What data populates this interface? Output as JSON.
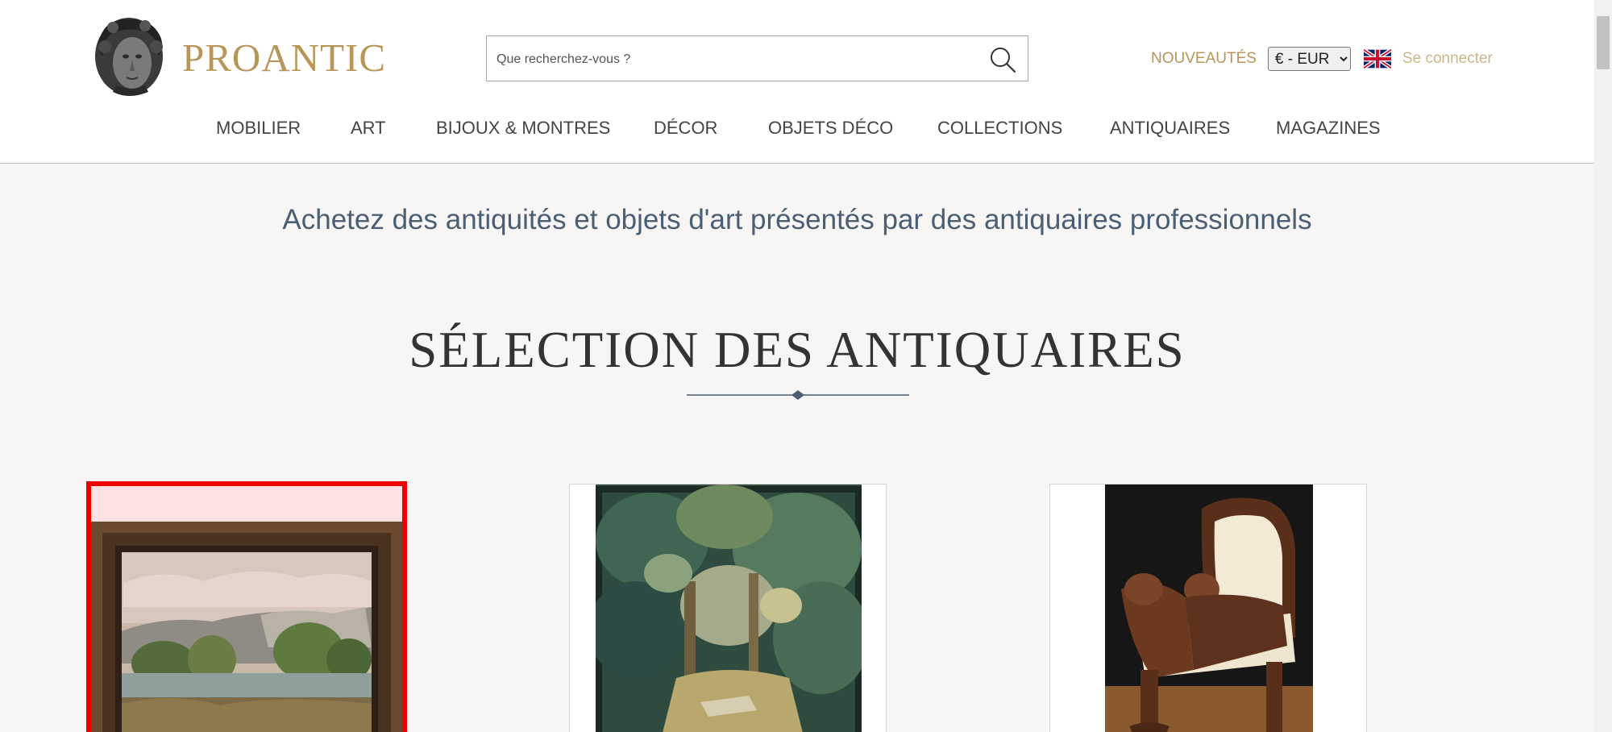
{
  "header": {
    "logo_text": "PROANTIC",
    "search": {
      "placeholder": "Que recherchez-vous ?"
    },
    "nouveautes_label": "NOUVEAUTÉS",
    "currency": {
      "selected": "€ - EUR"
    },
    "language_flag": "uk-flag-icon",
    "login_label": "Se connecter"
  },
  "nav": {
    "items": [
      {
        "label": "MOBILIER"
      },
      {
        "label": "ART"
      },
      {
        "label": "BIJOUX & MONTRES"
      },
      {
        "label": "DÉCOR"
      },
      {
        "label": "OBJETS DÉCO"
      },
      {
        "label": "COLLECTIONS"
      },
      {
        "label": "ANTIQUAIRES"
      },
      {
        "label": "MAGAZINES"
      }
    ]
  },
  "main": {
    "tagline": "Achetez des antiquités et objets d'art présentés par des antiquaires professionnels",
    "section_title": "SÉLECTION DES ANTIQUAIRES",
    "cards": [
      {
        "image": "framed-landscape-painting"
      },
      {
        "image": "verdure-tapestry"
      },
      {
        "image": "carved-lion-armchair"
      }
    ]
  },
  "colors": {
    "brand_gold": "#b8965a",
    "tagline_blue": "#4a5e75",
    "highlight_red": "#ee0000",
    "background": "#f7f6f4"
  }
}
